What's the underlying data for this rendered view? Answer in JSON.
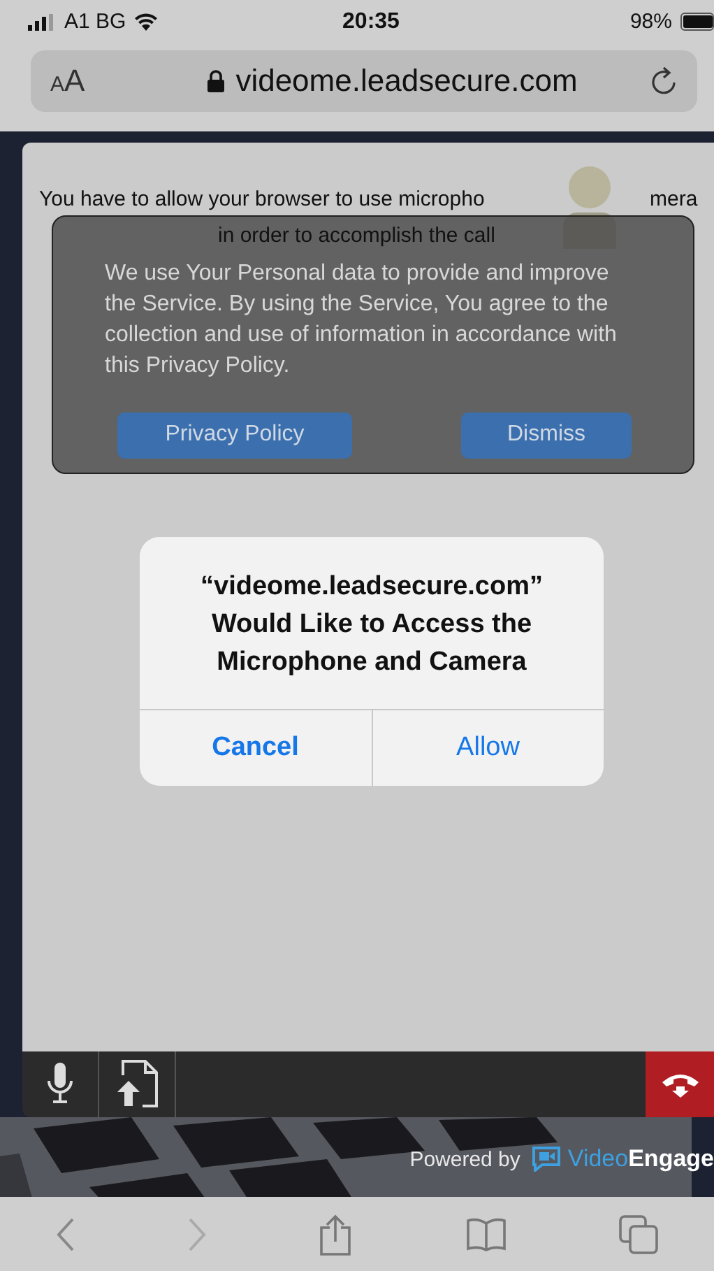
{
  "status_bar": {
    "carrier": "A1 BG",
    "time": "20:35",
    "battery": "98%"
  },
  "address_bar": {
    "text_size": "AA",
    "url": "videome.leadsecure.com"
  },
  "page": {
    "message_line_1": "You have to allow your browser to use micropho",
    "message_line_1_end": "mera",
    "message_line_2": "in order to accomplish the call"
  },
  "cookie_banner": {
    "text": "We use Your Personal data to provide and improve the Service. By using the Service, You agree to the collection and use of information in accordance with this Privacy Policy.",
    "buttons": [
      "Privacy Policy",
      "Dismiss"
    ]
  },
  "dialog": {
    "title": "“videome.leadsecure.com” Would Like to Access the Microphone and Camera",
    "buttons": [
      {
        "label": "Cancel",
        "kind": "cancel"
      },
      {
        "label": "Allow",
        "kind": "default"
      }
    ]
  },
  "footer": {
    "powered_by": "Powered by",
    "brand": "Video**Engage**"
  }
}
